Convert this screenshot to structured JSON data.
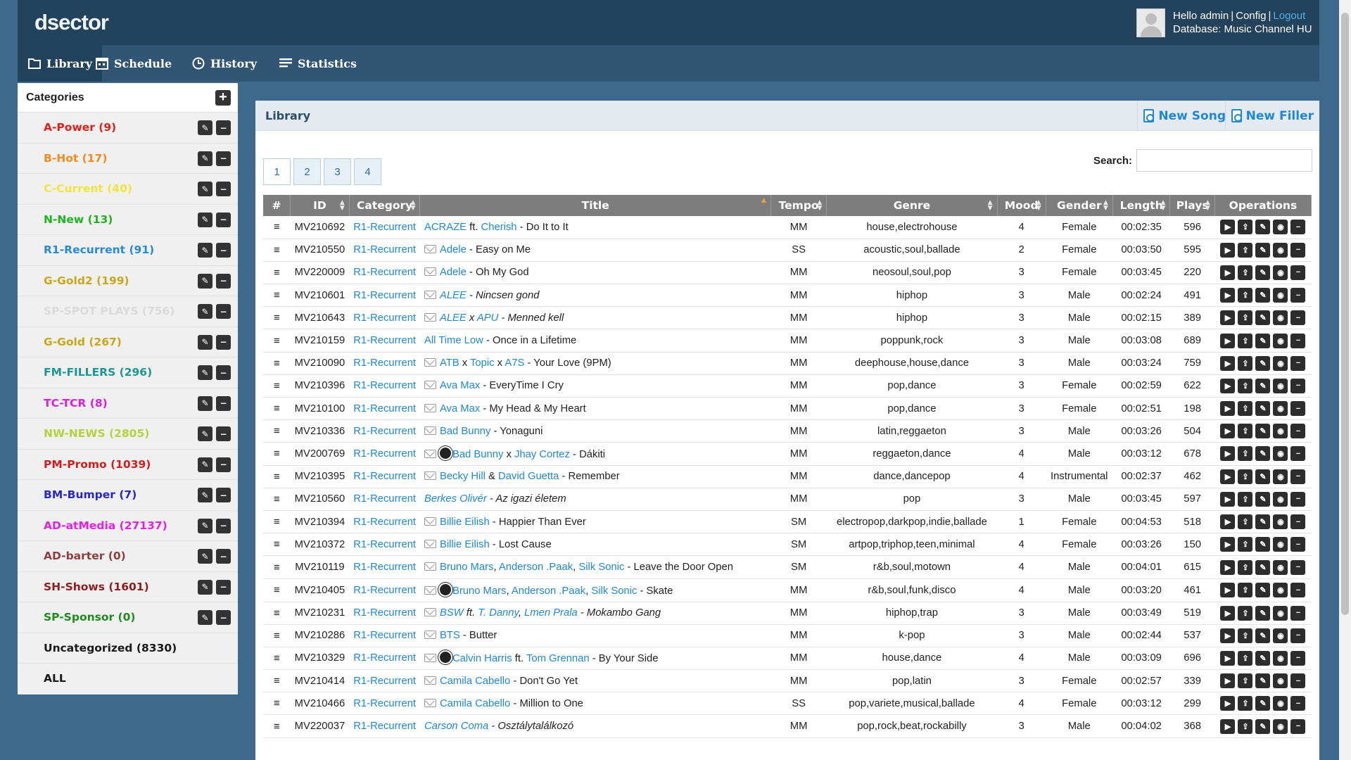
{
  "app": {
    "logo": "dsector",
    "greeting": "Hello admin",
    "config": "Config",
    "logout": "Logout",
    "database": "Database: Music Channel HU"
  },
  "nav": [
    {
      "label": "Library",
      "icon": "folder-icon"
    },
    {
      "label": "Schedule",
      "icon": "calendar-icon"
    },
    {
      "label": "History",
      "icon": "history-icon"
    },
    {
      "label": "Statistics",
      "icon": "list-icon"
    }
  ],
  "categories": {
    "title": "Categories",
    "items": [
      {
        "label": "A-Power (9)",
        "color": "#e0201a"
      },
      {
        "label": "B-Hot (17)",
        "color": "#f08c1e"
      },
      {
        "label": "C-Current (40)",
        "color": "#f2e43a"
      },
      {
        "label": "N-New (13)",
        "color": "#1eb41e"
      },
      {
        "label": "R1-Recurrent (91)",
        "color": "#2a8ad8"
      },
      {
        "label": "G-Gold2 (199)",
        "color": "#c8a81a"
      },
      {
        "label": "SP-SPOT PLAYS (756)",
        "color": "#dadada"
      },
      {
        "label": "G-Gold (267)",
        "color": "#c8a81a"
      },
      {
        "label": "FM-FILLERS (296)",
        "color": "#1e9696"
      },
      {
        "label": "TC-TCR (8)",
        "color": "#dc1edc"
      },
      {
        "label": "NW-NEWS (2805)",
        "color": "#b4d23c"
      },
      {
        "label": "PM-Promo (1039)",
        "color": "#d21e1e"
      },
      {
        "label": "BM-Bumper (7)",
        "color": "#2828c8"
      },
      {
        "label": "AD-atMedia (27137)",
        "color": "#e61ee6"
      },
      {
        "label": "AD-barter (0)",
        "color": "#8c4040"
      },
      {
        "label": "SH-Shows (1601)",
        "color": "#8c2020"
      },
      {
        "label": "SP-Sponsor (0)",
        "color": "#1e8c1e"
      },
      {
        "label": "Uncategorized (8330)",
        "color": "#1a1a1a"
      },
      {
        "label": "ALL",
        "color": "#1a1a1a"
      }
    ]
  },
  "library": {
    "title": "Library",
    "new_song": "New Song",
    "new_filler": "New Filler",
    "pages": [
      "1",
      "2",
      "3",
      "4"
    ],
    "search_label": "Search:",
    "columns": [
      "#",
      "ID",
      "Category",
      "Title",
      "Tempo",
      "Genre",
      "Mood",
      "Gender",
      "Length",
      "Plays",
      "Operations"
    ],
    "rows": [
      {
        "id": "MV210692",
        "cat": "R1-Recurrent",
        "title": [
          [
            "l",
            "ACRAZE"
          ],
          [
            "t",
            " ft. "
          ],
          [
            "l",
            "Cherish"
          ],
          [
            "t",
            " - Do It to It"
          ]
        ],
        "env": false,
        "sun": false,
        "tempo": "MM",
        "genre": "house,electrohouse",
        "mood": "4",
        "gender": "Female",
        "length": "00:02:35",
        "plays": "596"
      },
      {
        "id": "MV210550",
        "cat": "R1-Recurrent",
        "title": [
          [
            "l",
            "Adele"
          ],
          [
            "t",
            " - Easy on Me"
          ]
        ],
        "env": true,
        "sun": false,
        "tempo": "SS",
        "genre": "acoustic,soul,ballade",
        "mood": "2",
        "gender": "Female",
        "length": "00:03:50",
        "plays": "595"
      },
      {
        "id": "MV220009",
        "cat": "R1-Recurrent",
        "title": [
          [
            "l",
            "Adele"
          ],
          [
            "t",
            " - Oh My God"
          ]
        ],
        "env": true,
        "sun": false,
        "tempo": "MM",
        "genre": "neosoul,soul,pop",
        "mood": "3",
        "gender": "Female",
        "length": "00:03:45",
        "plays": "220"
      },
      {
        "id": "MV210601",
        "cat": "R1-Recurrent",
        "title": [
          [
            "li",
            "ALEE"
          ],
          [
            "ti",
            " - Nincsen gond"
          ]
        ],
        "env": true,
        "sun": false,
        "tempo": "MM",
        "genre": "hiphop",
        "mood": "3",
        "gender": "Male",
        "length": "00:02:24",
        "plays": "491"
      },
      {
        "id": "MV210643",
        "cat": "R1-Recurrent",
        "title": [
          [
            "li",
            "ALEE"
          ],
          [
            "ti",
            " x "
          ],
          [
            "li",
            "APU"
          ],
          [
            "ti",
            " - Menned kell"
          ]
        ],
        "env": true,
        "sun": false,
        "tempo": "MM",
        "genre": "hiphop",
        "mood": "3",
        "gender": "Male",
        "length": "00:02:15",
        "plays": "389"
      },
      {
        "id": "MV210159",
        "cat": "R1-Recurrent",
        "title": [
          [
            "l",
            "All Time Low"
          ],
          [
            "t",
            " - Once in a Lifetime"
          ]
        ],
        "env": false,
        "sun": false,
        "tempo": "MM",
        "genre": "poppunk,rock",
        "mood": "3",
        "gender": "Male",
        "length": "00:03:08",
        "plays": "689"
      },
      {
        "id": "MV210090",
        "cat": "R1-Recurrent",
        "title": [
          [
            "l",
            "ATB"
          ],
          [
            "t",
            " x "
          ],
          [
            "l",
            "Topic"
          ],
          [
            "t",
            " x "
          ],
          [
            "l",
            "A7S"
          ],
          [
            "t",
            " - Your Love (9PM)"
          ]
        ],
        "env": true,
        "sun": false,
        "tempo": "MM",
        "genre": "deephouse,house,dance",
        "mood": "3",
        "gender": "Male",
        "length": "00:03:24",
        "plays": "759"
      },
      {
        "id": "MV210396",
        "cat": "R1-Recurrent",
        "title": [
          [
            "l",
            "Ava Max"
          ],
          [
            "t",
            " - EveryTime I Cry"
          ]
        ],
        "env": true,
        "sun": false,
        "tempo": "MM",
        "genre": "pop,dance",
        "mood": "3",
        "gender": "Female",
        "length": "00:02:59",
        "plays": "622"
      },
      {
        "id": "MV210100",
        "cat": "R1-Recurrent",
        "title": [
          [
            "l",
            "Ava Max"
          ],
          [
            "t",
            " - My Head & My Heart"
          ]
        ],
        "env": true,
        "sun": false,
        "tempo": "MM",
        "genre": "pop,dance",
        "mood": "3",
        "gender": "Female",
        "length": "00:02:51",
        "plays": "198"
      },
      {
        "id": "MV210336",
        "cat": "R1-Recurrent",
        "title": [
          [
            "l",
            "Bad Bunny"
          ],
          [
            "t",
            " - Yonaguni"
          ]
        ],
        "env": true,
        "sun": false,
        "tempo": "MM",
        "genre": "latin,reggaeton",
        "mood": "3",
        "gender": "Male",
        "length": "00:03:26",
        "plays": "504"
      },
      {
        "id": "MV200769",
        "cat": "R1-Recurrent",
        "title": [
          [
            "l",
            "Bad Bunny"
          ],
          [
            "t",
            " x "
          ],
          [
            "l",
            "Jhay Cortez"
          ],
          [
            "t",
            " - Dákiti"
          ]
        ],
        "env": true,
        "sun": true,
        "tempo": "MM",
        "genre": "reggaeton,dance",
        "mood": "4",
        "gender": "Male",
        "length": "00:03:12",
        "plays": "678"
      },
      {
        "id": "MV210395",
        "cat": "R1-Recurrent",
        "title": [
          [
            "l",
            "Becky Hill"
          ],
          [
            "t",
            " & "
          ],
          [
            "l",
            "David Guetta"
          ],
          [
            "t",
            " - Remember"
          ]
        ],
        "env": true,
        "sun": false,
        "tempo": "MM",
        "genre": "dance,dancepop",
        "mood": "4",
        "gender": "Instrumental",
        "length": "00:02:37",
        "plays": "462"
      },
      {
        "id": "MV210560",
        "cat": "R1-Recurrent",
        "title": [
          [
            "li",
            "Berkes Olivér"
          ],
          [
            "ti",
            " - Az igazi életem"
          ]
        ],
        "env": false,
        "sun": false,
        "tempo": "MM",
        "genre": "pop",
        "mood": "3",
        "gender": "Male",
        "length": "00:03:45",
        "plays": "597"
      },
      {
        "id": "MV210394",
        "cat": "R1-Recurrent",
        "title": [
          [
            "l",
            "Billie Eilish"
          ],
          [
            "t",
            " - Happier Than Ever"
          ]
        ],
        "env": true,
        "sun": false,
        "tempo": "SM",
        "genre": "electropop,darkpop,indie,ballade",
        "mood": "1",
        "gender": "Female",
        "length": "00:04:53",
        "plays": "518"
      },
      {
        "id": "MV210372",
        "cat": "R1-Recurrent",
        "title": [
          [
            "l",
            "Billie Eilish"
          ],
          [
            "t",
            " - Lost Cause"
          ]
        ],
        "env": true,
        "sun": false,
        "tempo": "SM",
        "genre": "artpop,triphop,teen,minimal",
        "mood": "4",
        "gender": "Female",
        "length": "00:03:26",
        "plays": "150"
      },
      {
        "id": "MV210119",
        "cat": "R1-Recurrent",
        "title": [
          [
            "l",
            "Bruno Mars"
          ],
          [
            "t",
            ", "
          ],
          [
            "l",
            "Anderson .Paak"
          ],
          [
            "t",
            ", "
          ],
          [
            "l",
            "Silk Sonic"
          ],
          [
            "t",
            " - Leave the Door Open"
          ]
        ],
        "env": true,
        "sun": false,
        "wrap": true,
        "tempo": "SM",
        "genre": "r&b,soul,motown",
        "mood": "4",
        "gender": "Male",
        "length": "00:04:01",
        "plays": "615"
      },
      {
        "id": "MV210405",
        "cat": "R1-Recurrent",
        "title": [
          [
            "l",
            "Bruno Mars"
          ],
          [
            "t",
            ", "
          ],
          [
            "l",
            "Anderson .Paak"
          ],
          [
            "t",
            ", "
          ],
          [
            "l",
            "Silk Sonic"
          ],
          [
            "t",
            " - Skate"
          ]
        ],
        "env": true,
        "sun": true,
        "tempo": "MM",
        "genre": "r&b,soul,funk,disco",
        "mood": "4",
        "gender": "Male",
        "length": "00:03:20",
        "plays": "461"
      },
      {
        "id": "MV210231",
        "cat": "R1-Recurrent",
        "title": [
          [
            "li",
            "BSW"
          ],
          [
            "ti",
            " ft. "
          ],
          [
            "li",
            "T. Danny"
          ],
          [
            "ti",
            ", "
          ],
          [
            "li",
            "Lmen Prala"
          ],
          [
            "ti",
            " - Mokambo Gang"
          ]
        ],
        "env": true,
        "sun": false,
        "tempo": "MM",
        "genre": "hiphop,trap",
        "mood": "3",
        "gender": "Male",
        "length": "00:03:49",
        "plays": "519"
      },
      {
        "id": "MV210286",
        "cat": "R1-Recurrent",
        "title": [
          [
            "l",
            "BTS"
          ],
          [
            "t",
            " - Butter"
          ]
        ],
        "env": true,
        "sun": false,
        "tempo": "MM",
        "genre": "k-pop",
        "mood": "3",
        "gender": "Male",
        "length": "00:02:44",
        "plays": "537"
      },
      {
        "id": "MV210329",
        "cat": "R1-Recurrent",
        "title": [
          [
            "l",
            "Calvin Harris"
          ],
          [
            "t",
            " ft. "
          ],
          [
            "l",
            "Tom Grennan"
          ],
          [
            "t",
            " - By Your Side"
          ]
        ],
        "env": true,
        "sun": true,
        "tempo": "MM",
        "genre": "house,dance",
        "mood": "4",
        "gender": "Male",
        "length": "00:03:09",
        "plays": "696"
      },
      {
        "id": "MV210414",
        "cat": "R1-Recurrent",
        "title": [
          [
            "l",
            "Camila Cabello"
          ],
          [
            "t",
            " - Don't Go Yet"
          ]
        ],
        "env": true,
        "sun": false,
        "tempo": "MM",
        "genre": "pop,latin",
        "mood": "3",
        "gender": "Female",
        "length": "00:02:57",
        "plays": "339"
      },
      {
        "id": "MV210466",
        "cat": "R1-Recurrent",
        "title": [
          [
            "l",
            "Camila Cabello"
          ],
          [
            "t",
            " - Million to One"
          ]
        ],
        "env": true,
        "sun": false,
        "tempo": "SS",
        "genre": "pop,variete,musical,ballade",
        "mood": "4",
        "gender": "Female",
        "length": "00:03:12",
        "plays": "299"
      },
      {
        "id": "MV220037",
        "cat": "R1-Recurrent",
        "title": [
          [
            "li",
            "Carson Coma"
          ],
          [
            "ti",
            " - Osztálytalálkozó"
          ]
        ],
        "env": false,
        "sun": false,
        "tempo": "MM",
        "genre": "pop,rock,beat,rockabilly",
        "mood": "3",
        "gender": "Male",
        "length": "00:04:02",
        "plays": "368"
      }
    ]
  }
}
